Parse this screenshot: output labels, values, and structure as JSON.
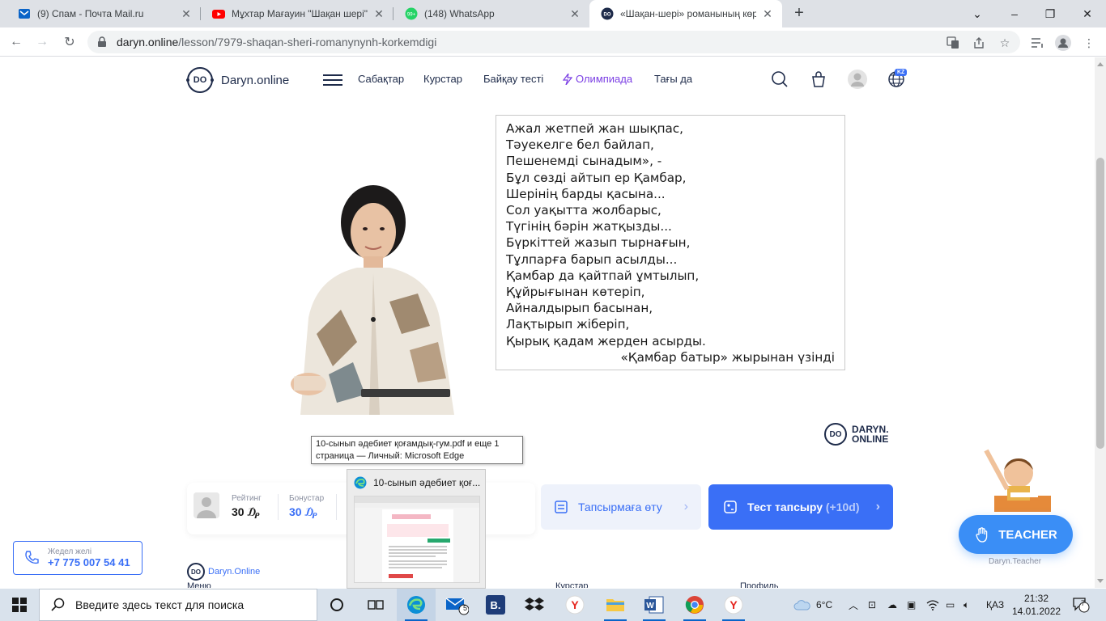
{
  "browser": {
    "tabs": [
      {
        "title": "(9) Спам - Почта Mail.ru",
        "icon": "mail-icon",
        "active": false
      },
      {
        "title": "Мұхтар Мағауин \"Шақан шері\" ро",
        "icon": "youtube-icon",
        "active": false
      },
      {
        "title": "(148) WhatsApp",
        "icon": "whatsapp-icon",
        "active": false
      },
      {
        "title": "«Шақан-шері» романының көрк",
        "icon": "daryn-icon",
        "active": true
      }
    ],
    "new_tab": "+",
    "address": {
      "host": "daryn.online",
      "path": "/lesson/7979-shaqan-sheri-romanynynh-korkemdigi"
    }
  },
  "site": {
    "logo_badge": "DO",
    "logo_text": "Daryn.online",
    "nav": [
      {
        "label": "Сабақтар"
      },
      {
        "label": "Курстар"
      },
      {
        "label": "Байқау тесті"
      },
      {
        "label": "Олимпиада"
      },
      {
        "label": "Тағы да"
      }
    ],
    "lang_badge": "KZ"
  },
  "video": {
    "poem_lines": [
      "Ажал жетпей жан шықпас,",
      "Тәуекелге бел байлап,",
      "Пешенемді сынадым», -",
      "Бұл сөзді айтып ер Қамбар,",
      "Шерінің барды қасына...",
      "Сол уақытта жолбарыс,",
      "Түгінің бәрін жатқызды...",
      "Бүркіттей жазып тырнағын,",
      "Тұлпарға барып асылды...",
      "Қамбар да қайтпай ұмтылып,",
      "Құйрығынан көтеріп,",
      "Айналдырып басынан,",
      "Лақтырып жіберіп,",
      "Қырық қадам жерден асырды."
    ],
    "poem_source": "«Қамбар батыр» жырынан үзінді",
    "brand_badge": "DO",
    "brand_line1": "DARYN.",
    "brand_line2": "ONLINE"
  },
  "stats": {
    "rating_label": "Рейтинг",
    "rating_value": "30 ₯",
    "bonus_label": "Бонустар",
    "bonus_value": "30 ₯"
  },
  "actions": {
    "task_label": "Тапсырмаға өту",
    "test_label": "Тест тапсыру",
    "test_bonus": "(+10d)"
  },
  "hotline": {
    "label": "Жедел желі",
    "phone": "+7 775 007 54 41"
  },
  "teacher": {
    "button": "TEACHER",
    "caption": "Daryn.Teacher"
  },
  "footer": {
    "logo_text": "Daryn.Online",
    "columns": [
      "Меню",
      "Курстар",
      "Профиль"
    ]
  },
  "tooltip": {
    "line1": "10-сынып әдебиет қоғамдық-гум.pdf и еще 1",
    "line2": "страница — Личный: Microsoft Edge"
  },
  "thumbnail": {
    "title": "10-сынып әдебиет қоғ..."
  },
  "taskbar": {
    "search_placeholder": "Введите здесь текст для поиска",
    "mail_badge": "5",
    "weather": "6°C",
    "lang": "ҚАЗ",
    "time": "21:32",
    "date": "14.01.2022",
    "notif_count": "7"
  },
  "colors": {
    "accent": "#3a6ff6",
    "teacher": "#3a8ef6",
    "olympiad": "#7b3fe4",
    "navy": "#1e2b4a"
  }
}
